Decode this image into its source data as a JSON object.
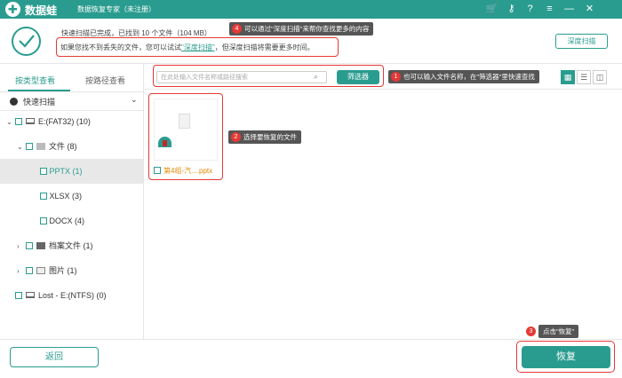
{
  "app": {
    "brand": "数据蛙",
    "subtitle": "数据恢复专家（未注册）"
  },
  "titlebar_icons": [
    "cart-icon",
    "key-icon",
    "help-icon",
    "menu-icon",
    "minimize-icon",
    "close-icon"
  ],
  "scan_status": {
    "summary": "快速扫描已完成，已找到 10 个文件（104 MB）",
    "hint_prefix": "如果您找不到丢失的文件，您可以试试",
    "hint_link": "\"深度扫描\"",
    "hint_suffix": "，但深度扫描将需要更多时间。",
    "deep_scan_button": "深度扫描"
  },
  "callouts": {
    "c1_num": "1",
    "c1_text": "也可以输入文件名称，在\"筛选器\"里快速查找",
    "c2_num": "2",
    "c2_text": "选择要恢复的文件",
    "c3_num": "3",
    "c3_text": "点击\"恢复\"",
    "c4_num": "4",
    "c4_text": "可以通过\"深度扫描\"来帮你查找更多的内容"
  },
  "sidebar": {
    "tab_type": "按类型查看",
    "tab_path": "按路径查看",
    "scan_mode": "快速扫描",
    "tree": [
      {
        "label": "E:(FAT32) (10)"
      },
      {
        "label": "文件 (8)"
      },
      {
        "label": "PPTX (1)"
      },
      {
        "label": "XLSX (3)"
      },
      {
        "label": "DOCX (4)"
      },
      {
        "label": "档案文件 (1)"
      },
      {
        "label": "图片 (1)"
      },
      {
        "label": "Lost - E:(NTFS) (0)"
      }
    ]
  },
  "toolbar": {
    "search_placeholder": "在此处输入文件名称或路径搜索",
    "filter_button": "筛选器"
  },
  "files": [
    {
      "name": "第4组-汽....pptx"
    }
  ],
  "footer": {
    "back_button": "返回",
    "recover_button": "恢复"
  },
  "colors": {
    "accent": "#2a9c8f",
    "annotation_red": "#e53935",
    "file_name_orange": "#e58a00"
  }
}
